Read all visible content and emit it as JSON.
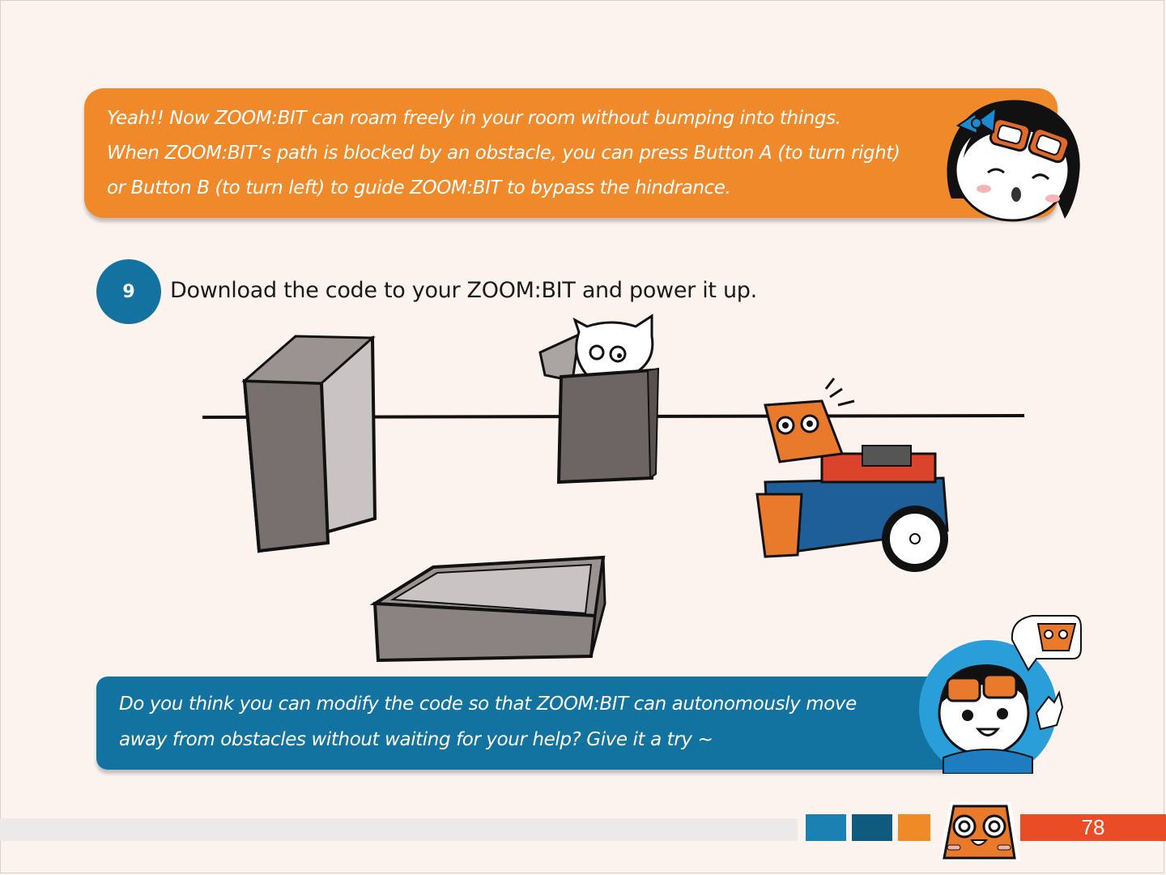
{
  "top_bubble": {
    "lines": [
      "Yeah!! Now ZOOM:BIT can roam freely in your room without bumping into things.",
      "When ZOOM:BIT’s path is blocked by an obstacle, you can press Button A (to turn right)",
      "or Button B (to turn left) to guide ZOOM:BIT to bypass the hindrance."
    ],
    "color": "#f0892a"
  },
  "step": {
    "number": "9",
    "text": "Download the code to your ZOOM:BIT and power it up.",
    "color": "#1472a0"
  },
  "bottom_bubble": {
    "lines": [
      "Do you think you can modify the code so that ZOOM:BIT can autonomously move",
      "away from obstacles without waiting for your help? Give it a try ~"
    ],
    "color": "#1272a0"
  },
  "footer": {
    "page_number": "78",
    "colors": [
      "#1b80b2",
      "#0f5a7f",
      "#f08a27",
      "#ea4d26"
    ]
  },
  "icons": [
    "girl-character-icon",
    "cat-in-box-icon",
    "zoombit-robot-icon",
    "boy-character-icon",
    "robot-speech-icon",
    "robot-logo-icon"
  ]
}
